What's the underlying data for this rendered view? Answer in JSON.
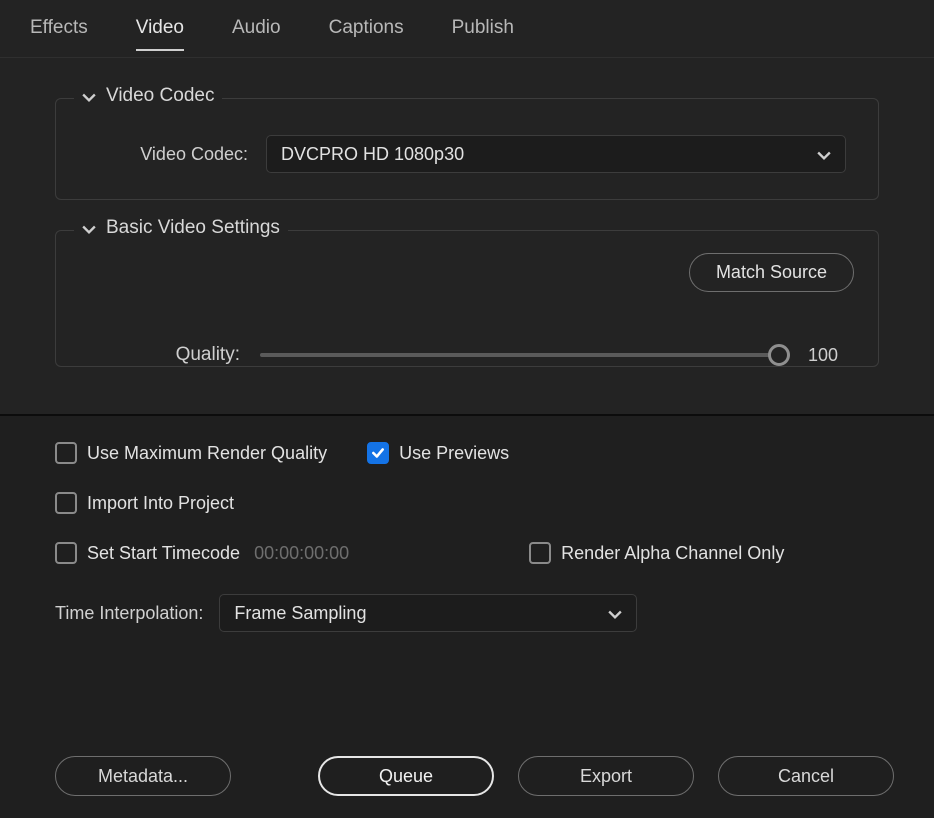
{
  "tabs": {
    "effects": "Effects",
    "video": "Video",
    "audio": "Audio",
    "captions": "Captions",
    "publish": "Publish"
  },
  "codec": {
    "section": "Video Codec",
    "label": "Video Codec:",
    "value": "DVCPRO HD 1080p30"
  },
  "basic": {
    "section": "Basic Video Settings",
    "match": "Match Source",
    "quality_label": "Quality:",
    "quality_value": "100"
  },
  "checks": {
    "max_render": "Use Maximum Render Quality",
    "previews": "Use Previews",
    "import": "Import Into Project",
    "start_tc": "Set Start Timecode",
    "tc_value": "00:00:00:00",
    "alpha": "Render Alpha Channel Only"
  },
  "interp": {
    "label": "Time Interpolation:",
    "value": "Frame Sampling"
  },
  "buttons": {
    "metadata": "Metadata...",
    "queue": "Queue",
    "export": "Export",
    "cancel": "Cancel"
  }
}
